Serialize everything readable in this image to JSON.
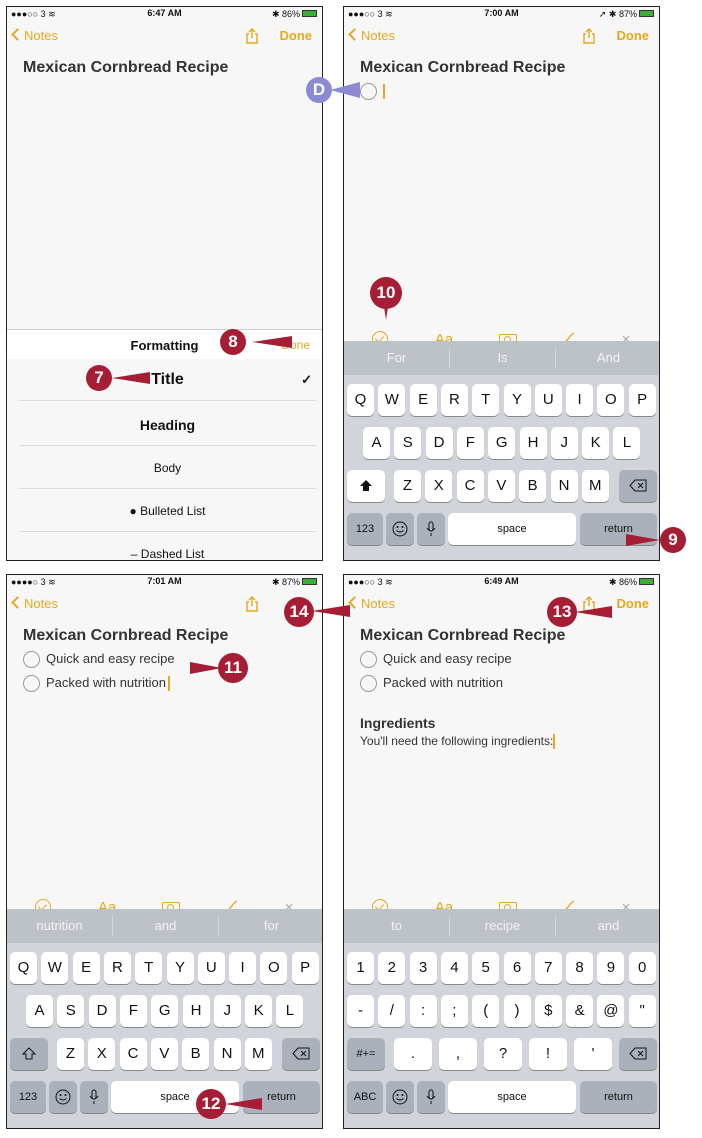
{
  "common": {
    "back": "Notes",
    "done": "Done",
    "note_title": "Mexican Cornbread Recipe",
    "toolbar": {
      "aa": "Aa",
      "close": "×"
    },
    "keys": {
      "row1": [
        "Q",
        "W",
        "E",
        "R",
        "T",
        "Y",
        "U",
        "I",
        "O",
        "P"
      ],
      "row2": [
        "A",
        "S",
        "D",
        "F",
        "G",
        "H",
        "J",
        "K",
        "L"
      ],
      "row3": [
        "Z",
        "X",
        "C",
        "V",
        "B",
        "N",
        "M"
      ],
      "num": "123",
      "space": "space",
      "return": "return"
    }
  },
  "p1": {
    "carrier": "●●●○○ 3 ≋",
    "time": "6:47 AM",
    "battery": "✱ 86%",
    "formatting": {
      "title": "Formatting",
      "done": "Done",
      "items": [
        "Title",
        "Heading",
        "Body",
        "● Bulleted List",
        "– Dashed List"
      ],
      "check": "✓"
    }
  },
  "p2": {
    "carrier": "●●●○○ 3 ≋",
    "time": "7:00 AM",
    "battery": "➚ ✱ 87%",
    "suggestions": [
      "For",
      "Is",
      "And"
    ]
  },
  "p3": {
    "carrier": "●●●●○ 3 ≋",
    "time": "7:01 AM",
    "battery": "✱ 87%",
    "items": [
      "Quick and easy recipe",
      "Packed with nutrition"
    ],
    "suggestions": [
      "nutrition",
      "and",
      "for"
    ]
  },
  "p4": {
    "carrier": "●●●○○ 3 ≋",
    "time": "6:49 AM",
    "battery": "✱ 86%",
    "items": [
      "Quick and easy recipe",
      "Packed with nutrition"
    ],
    "heading": "Ingredients",
    "body": "You'll need the following ingredients:",
    "suggestions": [
      "to",
      "recipe",
      "and"
    ],
    "numrow1": [
      "1",
      "2",
      "3",
      "4",
      "5",
      "6",
      "7",
      "8",
      "9",
      "0"
    ],
    "numrow2": [
      "-",
      "/",
      ":",
      ";",
      "(",
      ")",
      "$",
      "&",
      "@",
      "\""
    ],
    "numrow3": [
      ".",
      ",",
      "?",
      "!",
      "'"
    ],
    "sym": "#+=",
    "abc": "ABC"
  },
  "callouts": {
    "c7": "7",
    "c8": "8",
    "cD": "D",
    "c10": "10",
    "c9": "9",
    "c11": "11",
    "c12": "12",
    "c13": "13",
    "c14": "14"
  },
  "colors": {
    "accent": "#e4a91c",
    "callout": "#a51e35",
    "callout_alt": "#8d8ad4"
  }
}
